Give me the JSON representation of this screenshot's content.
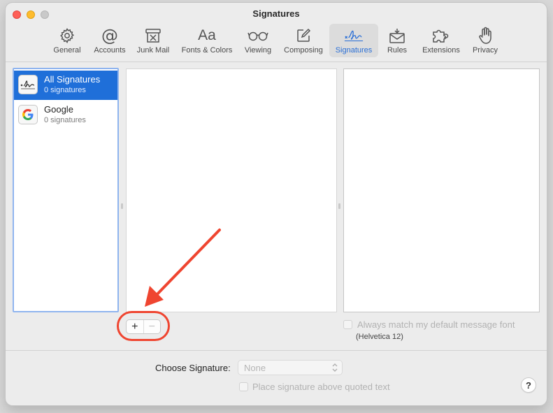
{
  "window": {
    "title": "Signatures"
  },
  "toolbar": {
    "items": [
      {
        "label": "General",
        "icon": "gear-icon",
        "active": false
      },
      {
        "label": "Accounts",
        "icon": "at-icon",
        "active": false
      },
      {
        "label": "Junk Mail",
        "icon": "junk-trash-icon",
        "active": false
      },
      {
        "label": "Fonts & Colors",
        "icon": "fonts-icon",
        "active": false
      },
      {
        "label": "Viewing",
        "icon": "glasses-icon",
        "active": false
      },
      {
        "label": "Composing",
        "icon": "compose-icon",
        "active": false
      },
      {
        "label": "Signatures",
        "icon": "signature-icon",
        "active": true
      },
      {
        "label": "Rules",
        "icon": "rules-envelope-icon",
        "active": false
      },
      {
        "label": "Extensions",
        "icon": "puzzle-icon",
        "active": false
      },
      {
        "label": "Privacy",
        "icon": "hand-icon",
        "active": false
      }
    ],
    "fonts_glyph": "Aa",
    "accounts_glyph": "@"
  },
  "signature_accounts": [
    {
      "name": "All Signatures",
      "count": "0 signatures",
      "selected": true,
      "icon": "signature-icon"
    },
    {
      "name": "Google",
      "count": "0 signatures",
      "selected": false,
      "icon": "google-logo-icon"
    }
  ],
  "buttons": {
    "add": "+",
    "remove": "−"
  },
  "options": {
    "match_font_label": "Always match my default message font",
    "font_hint": "(Helvetica 12)",
    "choose_signature_label": "Choose Signature:",
    "choose_signature_value": "None",
    "place_above_label": "Place signature above quoted text",
    "help": "?"
  },
  "colors": {
    "accent": "#1f6fd9",
    "annotation": "#ef4530"
  }
}
